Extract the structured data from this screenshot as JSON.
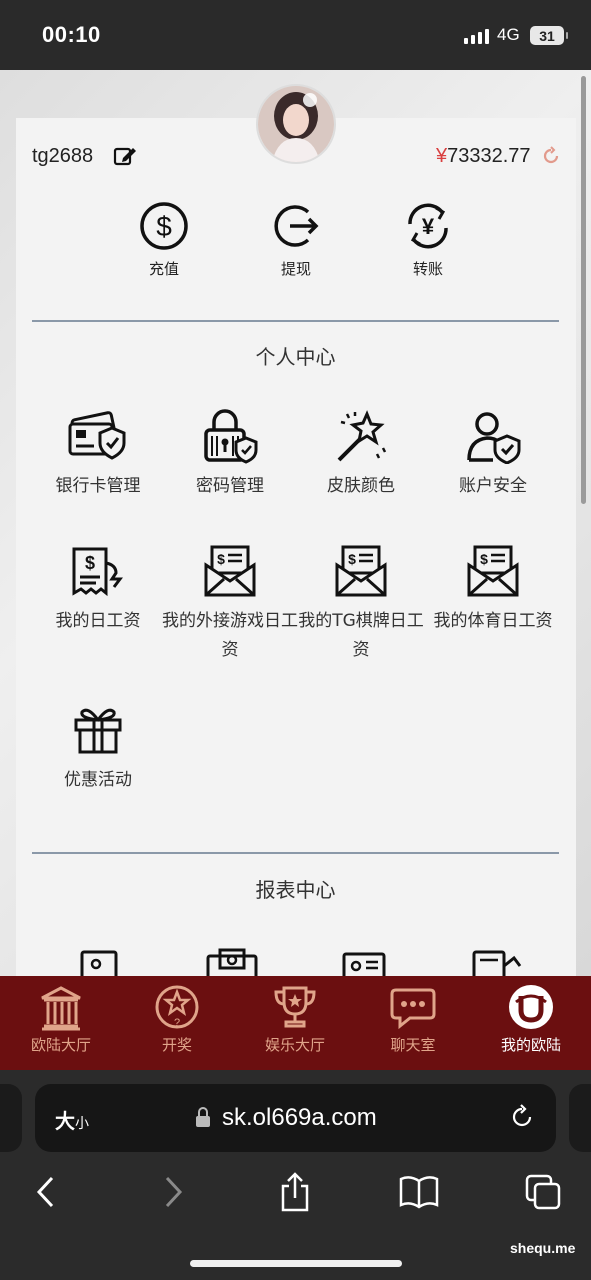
{
  "status_bar": {
    "time": "00:10",
    "network": "4G",
    "battery": "31"
  },
  "profile": {
    "username": "tg2688",
    "currency": "¥",
    "balance": "73332.77"
  },
  "quick_actions": [
    {
      "label": "充值",
      "icon": "dollar-circle-icon"
    },
    {
      "label": "提现",
      "icon": "withdraw-arrow-icon"
    },
    {
      "label": "转账",
      "icon": "yuan-exchange-icon"
    }
  ],
  "personal_center": {
    "title": "个人中心",
    "items": [
      {
        "label": "银行卡管理",
        "icon": "bank-card-shield-icon"
      },
      {
        "label": "密码管理",
        "icon": "padlock-shield-icon"
      },
      {
        "label": "皮肤颜色",
        "icon": "magic-wand-icon"
      },
      {
        "label": "账户安全",
        "icon": "user-shield-icon"
      },
      {
        "label": "我的日工资",
        "icon": "receipt-dollar-icon"
      },
      {
        "label": "我的外接游戏日工资",
        "icon": "envelope-dollar-icon"
      },
      {
        "label": "我的TG棋牌日工资",
        "icon": "envelope-dollar-icon"
      },
      {
        "label": "我的体育日工资",
        "icon": "envelope-dollar-icon"
      },
      {
        "label": "优惠活动",
        "icon": "gift-box-icon"
      }
    ]
  },
  "report_center": {
    "title": "报表中心"
  },
  "tabbar": {
    "items": [
      {
        "label": "欧陆大厅",
        "icon": "building-icon"
      },
      {
        "label": "开奖",
        "icon": "lottery-ball-icon"
      },
      {
        "label": "娱乐大厅",
        "icon": "trophy-icon"
      },
      {
        "label": "聊天室",
        "icon": "chat-bubble-icon"
      },
      {
        "label": "我的欧陆",
        "icon": "u-logo-icon"
      }
    ],
    "active_index": 4
  },
  "browser": {
    "text_size_big": "大",
    "text_size_small": "小",
    "url": "sk.ol669a.com"
  },
  "watermark": "shequ.me",
  "colors": {
    "tabbar_bg": "#6b0f10",
    "tab_label": "#e0a48a",
    "balance_currency": "#d94040"
  }
}
